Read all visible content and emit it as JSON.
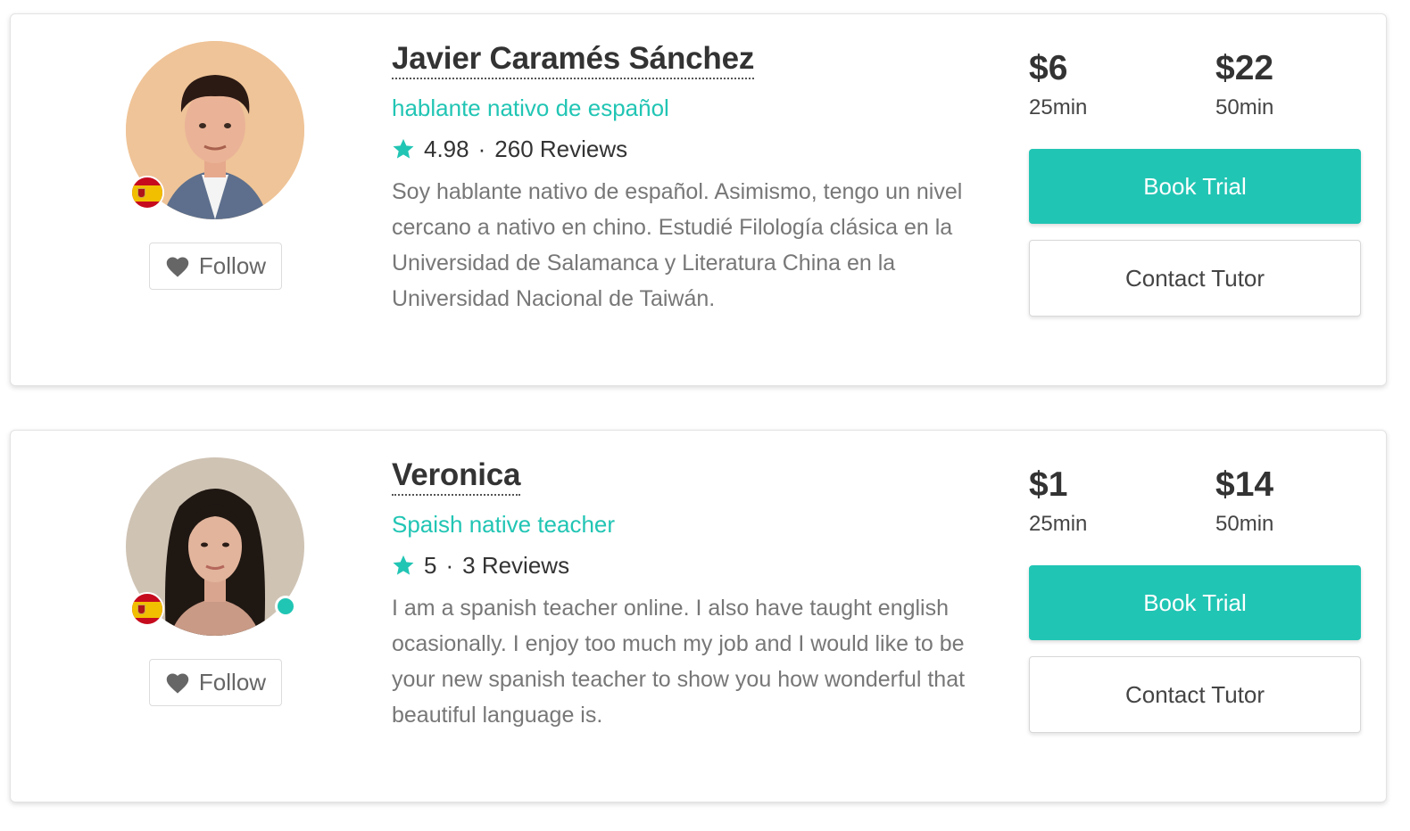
{
  "colors": {
    "accent": "#21c5b4",
    "text": "#333333",
    "muted": "#777777"
  },
  "tutors": [
    {
      "name": "Javier Caramés Sánchez",
      "headline": "hablante nativo de español",
      "rating": "4.98",
      "reviews": "260 Reviews",
      "bio": "Soy hablante nativo de español. Asimismo, tengo un nivel cercano a nativo en chino. Estudié Filología clásica en la Universidad de Salamanca y Literatura China en la Universidad Nacional de Taiwán.",
      "flag": "spain-flag",
      "online": false,
      "follow_label": "Follow",
      "prices": [
        {
          "price": "$6",
          "duration": "25min"
        },
        {
          "price": "$22",
          "duration": "50min"
        }
      ],
      "book_label": "Book Trial",
      "contact_label": "Contact Tutor"
    },
    {
      "name": "Veronica",
      "headline": "Spaish native teacher",
      "rating": "5",
      "reviews": "3 Reviews",
      "bio": "I am a spanish teacher online. I also have taught english ocasionally. I enjoy too much my job and I would like to be your new spanish teacher to show you how wonderful that beautiful language is.",
      "flag": "spain-flag",
      "online": true,
      "follow_label": "Follow",
      "prices": [
        {
          "price": "$1",
          "duration": "25min"
        },
        {
          "price": "$14",
          "duration": "50min"
        }
      ],
      "book_label": "Book Trial",
      "contact_label": "Contact Tutor"
    }
  ],
  "rating_separator": "·"
}
